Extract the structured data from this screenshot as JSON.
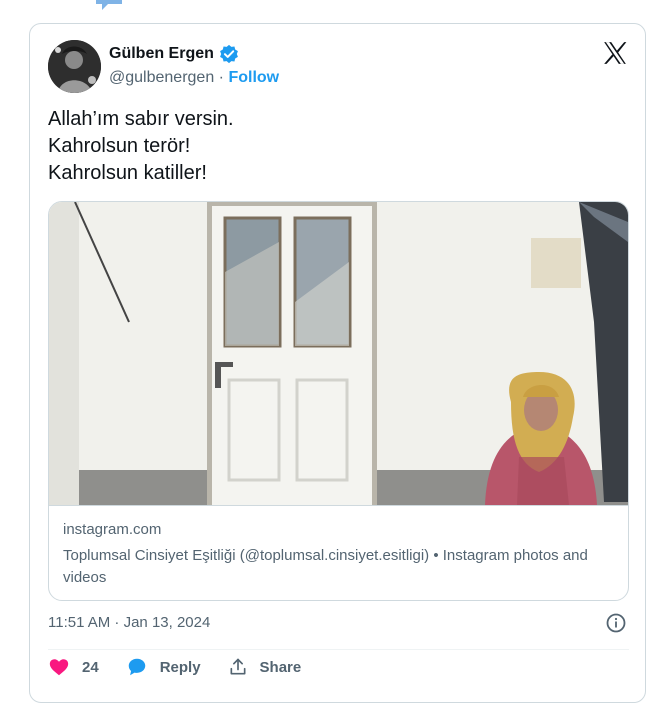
{
  "tweet": {
    "author_name": "Gülben Ergen",
    "author_handle": "@gulbenergen",
    "separator": "·",
    "follow_label": "Follow",
    "text_lines": [
      "Allah’ım sabır versin.",
      "Kahrolsun terör!",
      "Kahrolsun katiller!"
    ],
    "timestamp": "11:51 AM · Jan 13, 2024"
  },
  "embed": {
    "domain": "instagram.com",
    "description": "Toplumsal Cinsiyet Eşitliği (@toplumsal.cinsiyet.esitligi) • Instagram photos and videos"
  },
  "actions": {
    "likes": "24",
    "reply_label": "Reply",
    "share_label": "Share"
  },
  "colors": {
    "accent": "#1d9bf0",
    "like": "#f91880",
    "secondary_text": "#536471",
    "border": "#cfd9de"
  },
  "icons": [
    "speech-bubble-icon",
    "verified-badge-icon",
    "x-logo-icon",
    "info-icon",
    "heart-icon",
    "reply-bubble-icon",
    "share-icon"
  ]
}
